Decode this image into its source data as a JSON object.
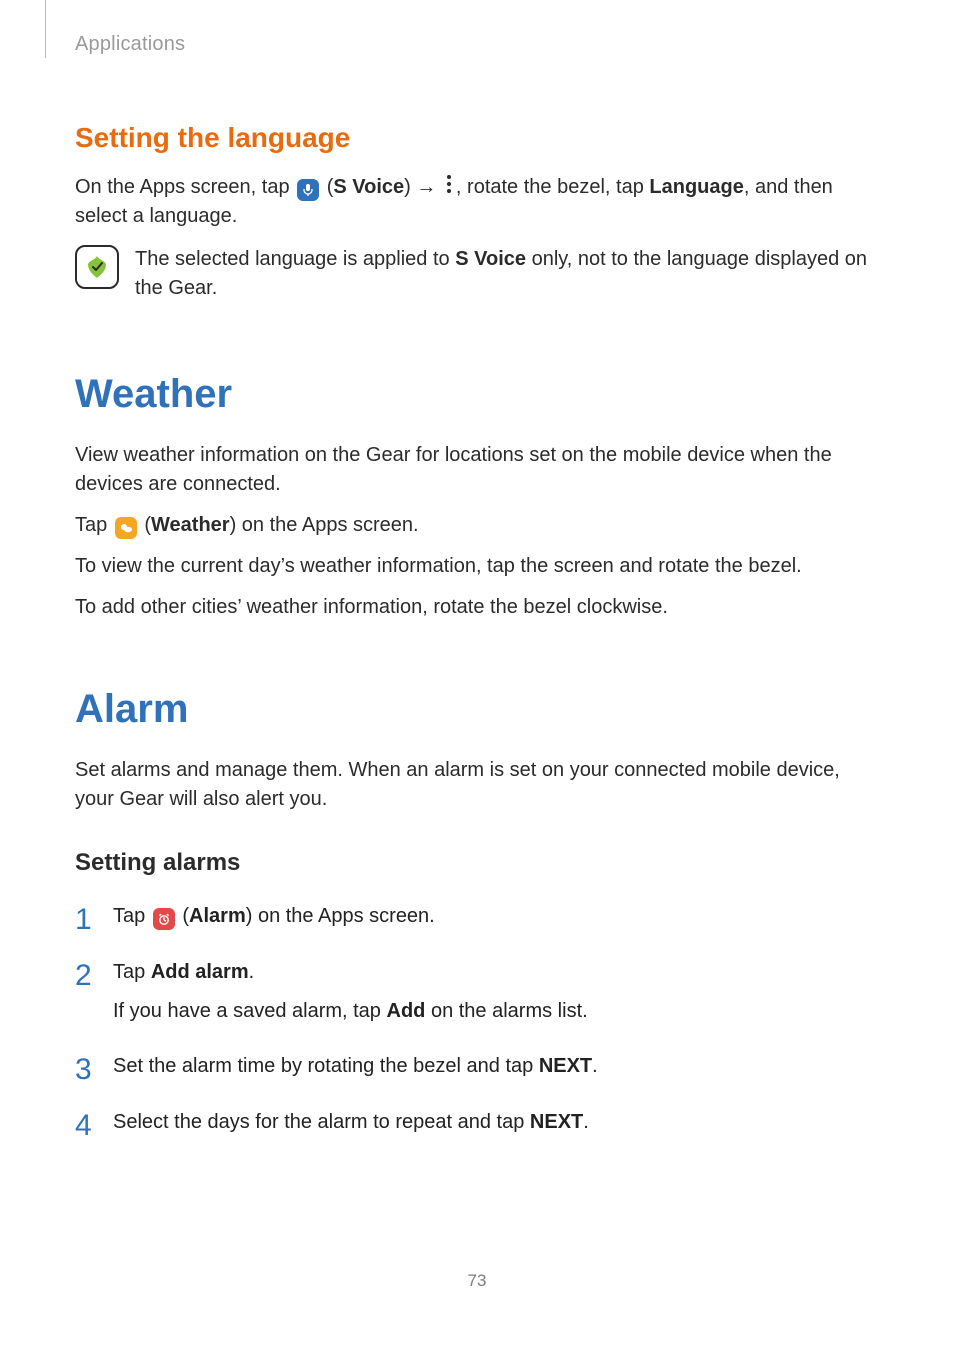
{
  "header": {
    "breadcrumb": "Applications"
  },
  "language": {
    "heading": "Setting the language",
    "p1a": "On the Apps screen, tap ",
    "p1b": " (",
    "p1c_bold": "S Voice",
    "p1d": ") ",
    "p1e": ", rotate the bezel, tap ",
    "p1f_bold": "Language",
    "p1g": ", and then select a language.",
    "note_a": "The selected language is applied to ",
    "note_b_bold": "S Voice",
    "note_c": " only, not to the language displayed on the Gear."
  },
  "weather": {
    "heading": "Weather",
    "p1": "View weather information on the Gear for locations set on the mobile device when the devices are connected.",
    "p2a": "Tap ",
    "p2b": " (",
    "p2c_bold": "Weather",
    "p2d": ") on the Apps screen.",
    "p3": "To view the current day’s weather information, tap the screen and rotate the bezel.",
    "p4": "To add other cities’ weather information, rotate the bezel clockwise."
  },
  "alarm": {
    "heading": "Alarm",
    "intro": "Set alarms and manage them. When an alarm is set on your connected mobile device, your Gear will also alert you.",
    "subheading": "Setting alarms",
    "step1_a": "Tap ",
    "step1_b": " (",
    "step1_c_bold": "Alarm",
    "step1_d": ") on the Apps screen.",
    "step2_a": "Tap ",
    "step2_b_bold": "Add alarm",
    "step2_c": ".",
    "step2_sub_a": "If you have a saved alarm, tap ",
    "step2_sub_b_bold": "Add",
    "step2_sub_c": " on the alarms list.",
    "step3_a": "Set the alarm time by rotating the bezel and tap ",
    "step3_b_bold": "NEXT",
    "step3_c": ".",
    "step4_a": "Select the days for the alarm to repeat and tap ",
    "step4_b_bold": "NEXT",
    "step4_c": "."
  },
  "arrow_glyph": "→",
  "page_number": "73"
}
